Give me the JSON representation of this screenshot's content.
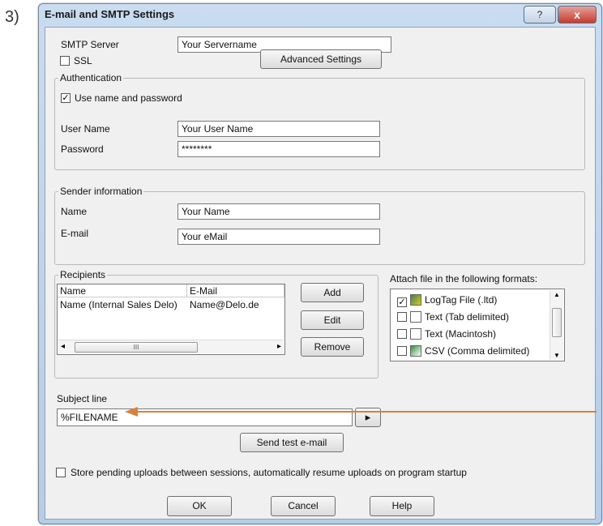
{
  "step_label": "3)",
  "window": {
    "title": "E-mail and SMTP Settings",
    "help_glyph": "?",
    "close_glyph": "x"
  },
  "smtp": {
    "server_label": "SMTP Server",
    "server_value": "Your Servername",
    "ssl_label": "SSL",
    "advanced_button": "Advanced Settings"
  },
  "authentication": {
    "group_label": "Authentication",
    "use_name_label": "Use name and password",
    "use_name_checked": true,
    "user_label": "User Name",
    "user_value": "Your User Name",
    "password_label": "Password",
    "password_value": "********"
  },
  "sender": {
    "group_label": "Sender information",
    "name_label": "Name",
    "name_value": "Your Name",
    "email_label": "E-mail",
    "email_value": "Your eMail"
  },
  "recipients": {
    "group_label": "Recipients",
    "columns": [
      "Name",
      "E-Mail"
    ],
    "rows": [
      {
        "name": "Name (Internal Sales Delo)",
        "email": "Name@Delo.de"
      }
    ],
    "scroll_mid": "III",
    "add_button": "Add",
    "edit_button": "Edit",
    "remove_button": "Remove"
  },
  "attach": {
    "label": "Attach file in the following formats:",
    "formats": [
      {
        "label": "LogTag File (.ltd)",
        "checked": true,
        "icon": "logtag-file-icon"
      },
      {
        "label": "Text (Tab delimited)",
        "checked": false,
        "icon": "text-file-icon"
      },
      {
        "label": "Text (Macintosh)",
        "checked": false,
        "icon": "text-file-icon"
      },
      {
        "label": "CSV (Comma delimited)",
        "checked": false,
        "icon": "csv-file-icon"
      }
    ]
  },
  "subject": {
    "label": "Subject line",
    "value": "%FILENAME",
    "insert_glyph": "▸"
  },
  "send_test_button": "Send test e-mail",
  "store_pending_label": "Store pending uploads between sessions, automatically resume uploads on program startup",
  "footer": {
    "ok": "OK",
    "cancel": "Cancel",
    "help": "Help"
  },
  "colors": {
    "arrow": "#d9803a",
    "title_bar": "#c9dcf0",
    "close": "#c63b2d"
  }
}
